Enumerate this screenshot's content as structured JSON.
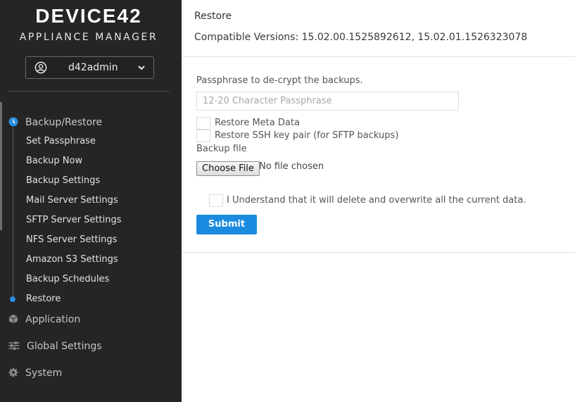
{
  "app": {
    "logo_text": "DEVICE42",
    "subtitle": "APPLIANCE MANAGER"
  },
  "user": {
    "name": "d42admin",
    "icon": "user-circle-icon"
  },
  "nav": {
    "backup_restore": {
      "label": "Backup/Restore",
      "icon": "clock-icon",
      "items": [
        {
          "label": "Set Passphrase"
        },
        {
          "label": "Backup Now"
        },
        {
          "label": "Backup Settings"
        },
        {
          "label": "Mail Server Settings"
        },
        {
          "label": "SFTP Server Settings"
        },
        {
          "label": "NFS Server Settings"
        },
        {
          "label": "Amazon S3 Settings"
        },
        {
          "label": "Backup Schedules"
        },
        {
          "label": "Restore"
        }
      ],
      "active_item": "Restore"
    },
    "application": {
      "label": "Application",
      "icon": "cube-icon"
    },
    "global_settings": {
      "label": "Global Settings",
      "icon": "sliders-icon"
    },
    "system": {
      "label": "System",
      "icon": "gear-icon"
    }
  },
  "main": {
    "title": "Restore",
    "compatible_versions": "Compatible Versions: 15.02.00.1525892612, 15.02.01.1526323078"
  },
  "form": {
    "passphrase_label": "Passphrase to de-crypt the backups.",
    "passphrase_placeholder": "12-20 Character Passphrase",
    "passphrase_value": "",
    "restore_meta_label": "Restore Meta Data",
    "restore_meta_checked": false,
    "restore_ssh_label": "Restore SSH key pair (for SFTP backups)",
    "restore_ssh_checked": false,
    "backup_file_label": "Backup file",
    "choose_file_button": "Choose File",
    "file_status": "No file chosen",
    "confirm_label": "I Understand that it will delete and overwrite all the current data.",
    "confirm_checked": false,
    "submit_label": "Submit"
  },
  "colors": {
    "sidebar_bg": "#252526",
    "accent": "#1a8bdf",
    "active_dot": "#2a8fe0"
  }
}
